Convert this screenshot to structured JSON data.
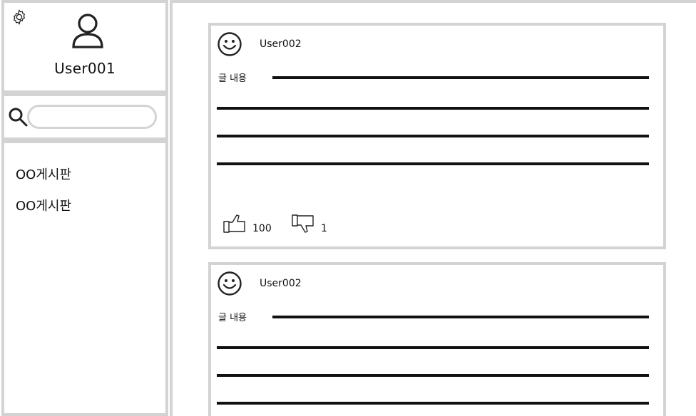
{
  "sidebar": {
    "profile": {
      "settings_icon": "gear-icon",
      "avatar_icon": "user-icon",
      "username": "User001"
    },
    "search": {
      "icon": "search-icon",
      "placeholder": "",
      "value": ""
    },
    "boards": [
      {
        "label": "OO게시판"
      },
      {
        "label": "OO게시판"
      }
    ]
  },
  "posts": [
    {
      "avatar_icon": "smiley-icon",
      "author": "User002",
      "content_label": "글 내용",
      "likes": "100",
      "dislikes": "1"
    },
    {
      "avatar_icon": "smiley-icon",
      "author": "User002",
      "content_label": "글 내용"
    }
  ],
  "colors": {
    "border": "#d3d3d3",
    "text": "#111111",
    "background": "#ffffff"
  }
}
